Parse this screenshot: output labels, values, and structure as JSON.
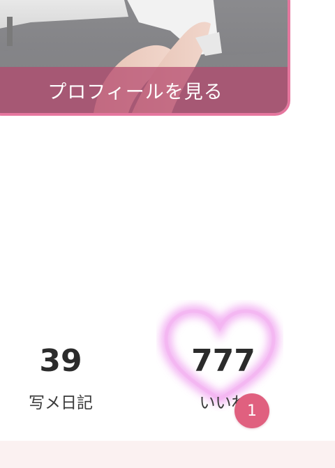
{
  "profile": {
    "view_profile_label": "プロフィールを見る"
  },
  "stats": {
    "diary": {
      "count": "39",
      "label": "写メ日記"
    },
    "likes": {
      "count": "777",
      "label": "いいね",
      "badge": "1"
    }
  },
  "colors": {
    "accent_pink": "#e5769e",
    "badge_pink": "#e0607f",
    "heart_glow": "#e873e8",
    "bottom_band": "#fbf1f1"
  },
  "icons": {
    "heart": "heart-icon"
  }
}
